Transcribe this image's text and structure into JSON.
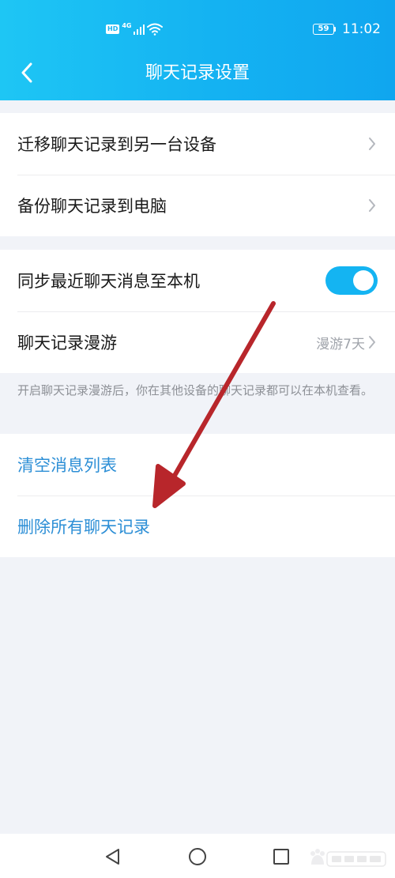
{
  "status_bar": {
    "hd_badge": "HD",
    "network_type": "4G",
    "battery_level": "59",
    "time": "11:02"
  },
  "header": {
    "title": "聊天记录设置",
    "back_icon": "chevron-left-icon"
  },
  "group1": {
    "items": [
      {
        "label": "迁移聊天记录到另一台设备",
        "icon": "chevron-right-icon"
      },
      {
        "label": "备份聊天记录到电脑",
        "icon": "chevron-right-icon"
      }
    ]
  },
  "group2": {
    "sync": {
      "label": "同步最近聊天消息至本机",
      "enabled": true
    },
    "roaming": {
      "label": "聊天记录漫游",
      "value": "漫游7天"
    }
  },
  "hint": "开启聊天记录漫游后，你在其他设备的聊天记录都可以在本机查看。",
  "group3": {
    "items": [
      {
        "label": "清空消息列表"
      },
      {
        "label": "删除所有聊天记录"
      }
    ]
  },
  "bottom_nav": {
    "back": "triangle-back-icon",
    "home": "circle-home-icon",
    "recents": "square-recents-icon"
  },
  "colors": {
    "header_start": "#1ec6f4",
    "header_end": "#10a6ef",
    "toggle_on": "#14b4f2",
    "link": "#2d8fd6",
    "annotation_arrow": "#b8262b"
  }
}
